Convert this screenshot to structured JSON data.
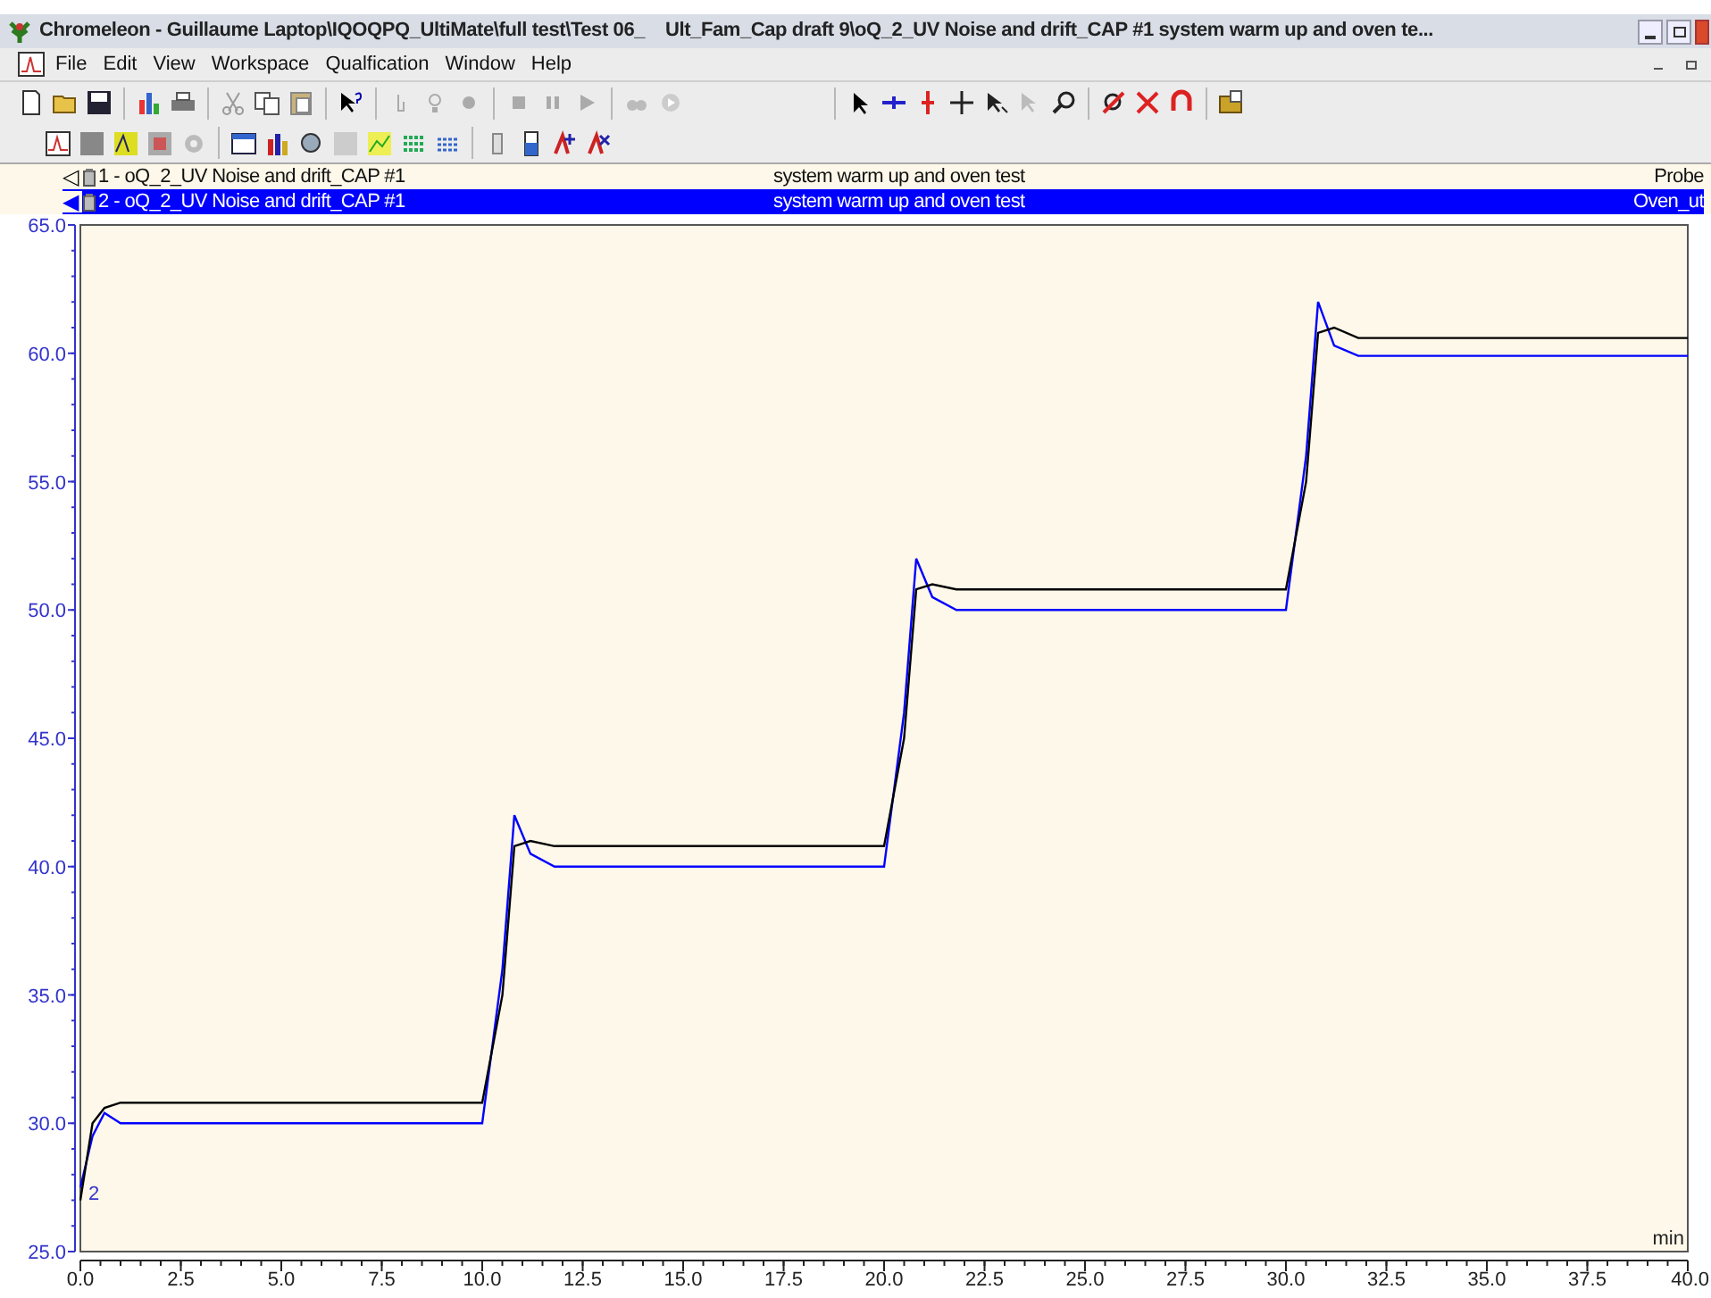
{
  "window": {
    "title": "Chromeleon - Guillaume Laptop\\IQOQPQ_UltiMate\\full test\\Test 06_    Ult_Fam_Cap draft 9\\oQ_2_UV Noise and drift_CAP #1 system warm up and oven te..."
  },
  "menu": [
    "File",
    "Edit",
    "View",
    "Workspace",
    "Qualfication",
    "Window",
    "Help"
  ],
  "legend": [
    {
      "marker": "◁",
      "description": "system warm up and oven test",
      "channel": "Probe",
      "selected": false
    },
    {
      "marker": "◀",
      "description": "system warm up and oven test",
      "channel": "Oven_ut",
      "selected": true
    }
  ],
  "chart": {
    "chart_data": {
      "type": "line",
      "xlabel": "min",
      "x": [
        0,
        0.3,
        0.6,
        1,
        10,
        10.5,
        10.8,
        11.2,
        11.8,
        20,
        20.5,
        20.8,
        21.2,
        21.8,
        30,
        30.5,
        30.8,
        31.2,
        31.8,
        40
      ],
      "series": [
        {
          "name": "1 - oQ_2_UV Noise and drift_CAP #1",
          "color": "#000000",
          "values": [
            27,
            30,
            30.6,
            30.8,
            30.8,
            35,
            40.8,
            41,
            40.8,
            40.8,
            45,
            50.8,
            51,
            50.8,
            50.8,
            55,
            60.8,
            61,
            60.6,
            60.6
          ]
        },
        {
          "name": "2 - oQ_2_UV Noise and drift_CAP #1",
          "color": "#0000ff",
          "values": [
            27.5,
            29.5,
            30.4,
            30,
            30,
            36,
            42,
            40.5,
            40,
            40,
            46,
            52,
            50.5,
            50,
            50,
            56,
            62,
            60.3,
            59.9,
            59.9
          ]
        }
      ],
      "xlim": [
        0,
        40
      ],
      "ylim": [
        25,
        65
      ],
      "xticks": [
        {
          "value": 0,
          "label": "0.0"
        },
        {
          "value": 2.5,
          "label": "2.5"
        },
        {
          "value": 5,
          "label": "5.0"
        },
        {
          "value": 7.5,
          "label": "7.5"
        },
        {
          "value": 10,
          "label": "10.0"
        },
        {
          "value": 12.5,
          "label": "12.5"
        },
        {
          "value": 15,
          "label": "15.0"
        },
        {
          "value": 17.5,
          "label": "17.5"
        },
        {
          "value": 20,
          "label": "20.0"
        },
        {
          "value": 22.5,
          "label": "22.5"
        },
        {
          "value": 25,
          "label": "25.0"
        },
        {
          "value": 27.5,
          "label": "27.5"
        },
        {
          "value": 30,
          "label": "30.0"
        },
        {
          "value": 32.5,
          "label": "32.5"
        },
        {
          "value": 35,
          "label": "35.0"
        },
        {
          "value": 37.5,
          "label": "37.5"
        },
        {
          "value": 40,
          "label": "40.0"
        }
      ],
      "yticks": [
        {
          "value": 25,
          "label": "25.0"
        },
        {
          "value": 30,
          "label": "30.0"
        },
        {
          "value": 35,
          "label": "35.0"
        },
        {
          "value": 40,
          "label": "40.0"
        },
        {
          "value": 45,
          "label": "45.0"
        },
        {
          "value": 50,
          "label": "50.0"
        },
        {
          "value": 55,
          "label": "55.0"
        },
        {
          "value": 60,
          "label": "60.0"
        },
        {
          "value": 65,
          "label": "65.0"
        }
      ],
      "annotations": [
        {
          "x": 0.2,
          "y": 27.3,
          "text": "2"
        }
      ]
    }
  }
}
